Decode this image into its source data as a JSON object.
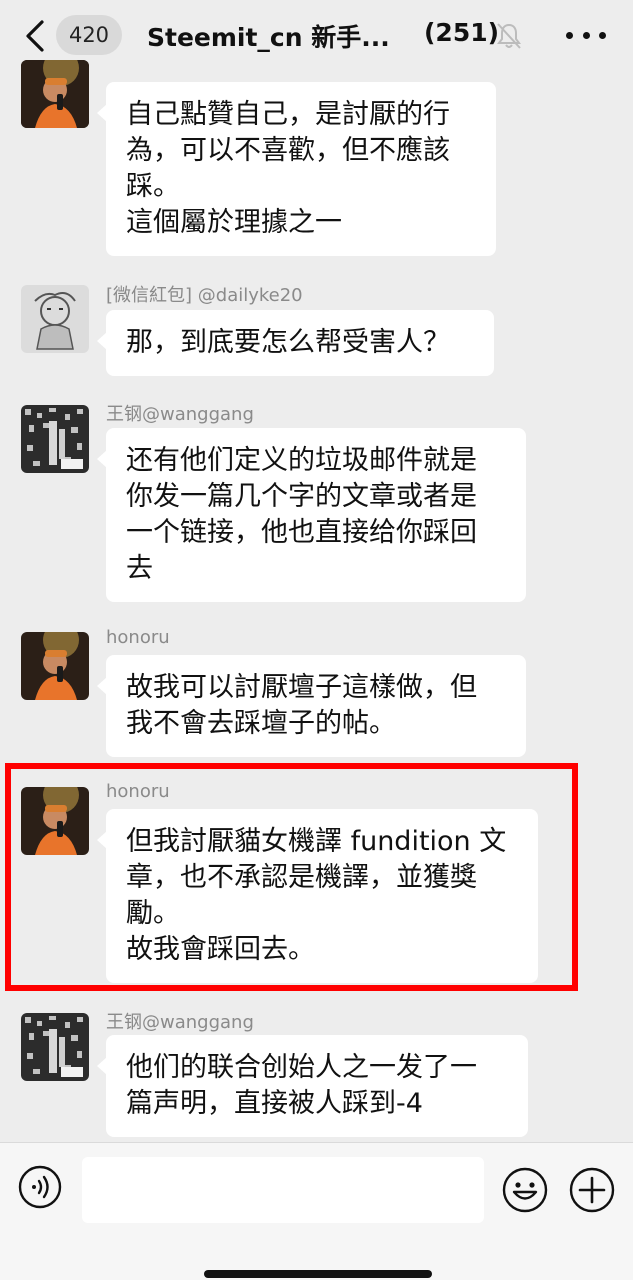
{
  "header": {
    "back_icon": "chevron-left-icon",
    "unread_count": "420",
    "title": "Steemit_cn 新手...",
    "member_count": "(251)",
    "mute_icon": "bell-muted-icon",
    "more_icon": "more-dots-icon"
  },
  "messages": [
    {
      "sender": "",
      "avatar": "honoru-avatar",
      "text": "自己點贊自己，是討厭的行\n為，可以不喜歡，但不應該\n踩。\n這個屬於理據之一"
    },
    {
      "sender": "[微信紅包] @dailyke20",
      "avatar": "dailyke20-avatar",
      "text": "那，到底要怎么帮受害人？"
    },
    {
      "sender": "王钢@wanggang",
      "avatar": "wanggang-avatar",
      "text": "还有他们定义的垃圾邮件就是\n你发一篇几个字的文章或者是\n一个链接，他也直接给你踩回\n去"
    },
    {
      "sender": "honoru",
      "avatar": "honoru-avatar",
      "text": "故我可以討厭壇子這樣做，但\n我不會去踩壇子的帖。"
    },
    {
      "sender": "honoru",
      "avatar": "honoru-avatar",
      "text": "但我討厭貓女機譯 fundition 文\n章，也不承認是機譯，並獲獎\n勵。\n故我會踩回去。"
    },
    {
      "sender": "王钢@wanggang",
      "avatar": "wanggang-avatar",
      "text": "他们的联合创始人之一发了一\n篇声明，直接被人踩到-4"
    }
  ],
  "input_bar": {
    "voice_icon": "voice-icon",
    "message_value": "",
    "emoji_icon": "emoji-icon",
    "plus_icon": "plus-icon"
  },
  "colors": {
    "background": "#ededed",
    "bubble": "#ffffff",
    "highlight": "#ff0000",
    "sender_text": "#8a8a8a"
  }
}
